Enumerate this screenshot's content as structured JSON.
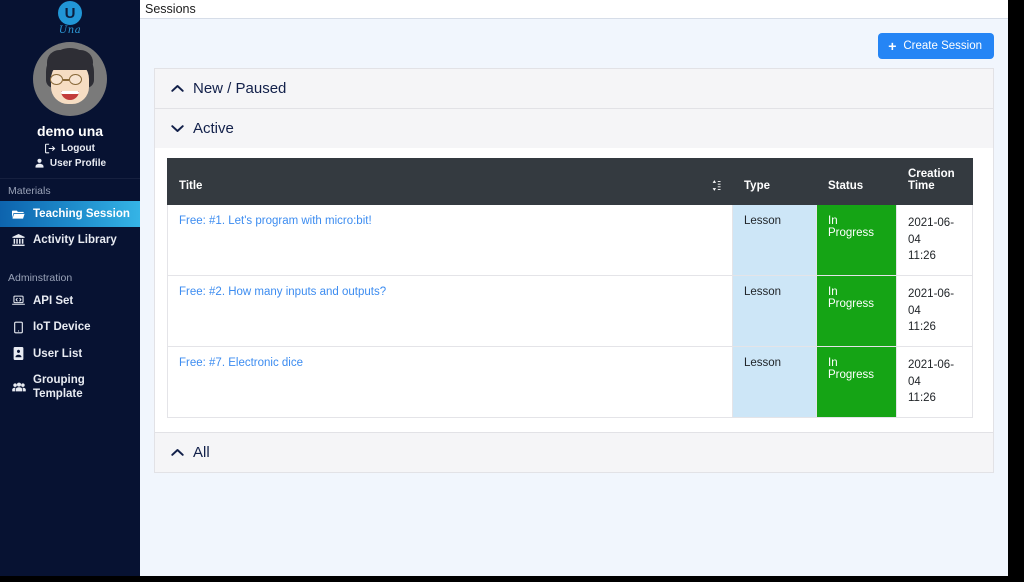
{
  "sidebar": {
    "logo": {
      "mark": "U",
      "wordmark": "Una",
      "icon": "una-logo-icon"
    },
    "avatar_icon": "user-avatar-illustration",
    "user_name": "demo una",
    "links": [
      {
        "label": "Logout",
        "icon": "logout-icon"
      },
      {
        "label": "User Profile",
        "icon": "user-profile-icon"
      }
    ],
    "groups": [
      {
        "title": "Materials",
        "items": [
          {
            "label": "Teaching Session",
            "icon": "folder-open-icon",
            "active": true
          },
          {
            "label": "Activity Library",
            "icon": "bank-icon",
            "active": false
          }
        ]
      },
      {
        "title": "Adminstration",
        "items": [
          {
            "label": "API Set",
            "icon": "laptop-code-icon",
            "active": false
          },
          {
            "label": "IoT Device",
            "icon": "tablet-icon",
            "active": false
          },
          {
            "label": "User List",
            "icon": "id-badge-icon",
            "active": false
          },
          {
            "label": "Grouping Template",
            "icon": "users-icon",
            "active": false
          }
        ]
      }
    ]
  },
  "topbar": {
    "title": "Sessions"
  },
  "toolbar": {
    "create_label": "Create Session",
    "create_icon": "plus-icon"
  },
  "panels": [
    {
      "label": "New / Paused",
      "expanded": false,
      "chevron": "chevron-up-icon"
    },
    {
      "label": "Active",
      "expanded": true,
      "chevron": "chevron-down-icon"
    },
    {
      "label": "All",
      "expanded": false,
      "chevron": "chevron-up-icon"
    }
  ],
  "table": {
    "sort_icon": "sort-updown-icon",
    "columns": [
      "Title",
      "Type",
      "Status",
      "Creation Time"
    ],
    "rows": [
      {
        "title": "Free: #1. Let's program with micro:bit!",
        "type": "Lesson",
        "status": "In Progress",
        "created_date": "2021-06-04",
        "created_time": "11:26"
      },
      {
        "title": "Free: #2. How many inputs and outputs?",
        "type": "Lesson",
        "status": "In Progress",
        "created_date": "2021-06-04",
        "created_time": "11:26"
      },
      {
        "title": "Free: #7. Electronic dice",
        "type": "Lesson",
        "status": "In Progress",
        "created_date": "2021-06-04",
        "created_time": "11:26"
      }
    ]
  },
  "colors": {
    "sidebar_bg": "#071232",
    "accent_blue": "#2585f5",
    "active_nav": "#1f8ecd",
    "status_green": "#15a415",
    "type_blue": "#cde6f7",
    "link_blue": "#3c8cf0",
    "table_header": "#343a40",
    "page_bg": "#f1f6fd"
  }
}
